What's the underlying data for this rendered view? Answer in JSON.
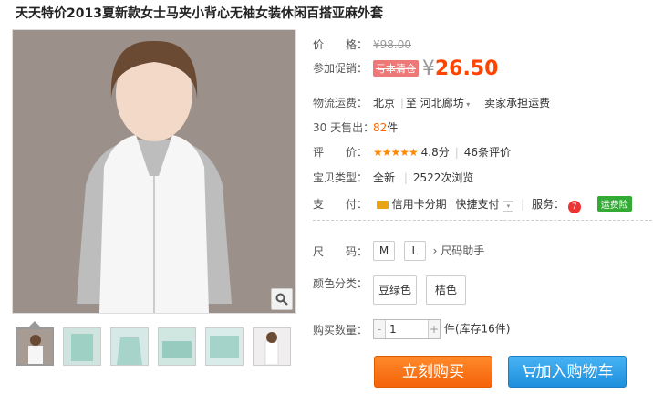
{
  "title": "天天特价2013夏新款女士马夹小背心无袖女装休闲百搭亚麻外套",
  "price": {
    "label": "价　　格：",
    "original": "¥98.00"
  },
  "promo": {
    "label": "参加促销：",
    "tag": "亏本清仓",
    "yen": "¥",
    "value": "26.50"
  },
  "shipping": {
    "label": "物流运费：",
    "from": "北京",
    "to_prefix": "至",
    "to": "河北廊坊",
    "fee": "卖家承担运费"
  },
  "sold": {
    "label": "30 天售出：",
    "count": "82",
    "unit": "件"
  },
  "rating": {
    "label": "评　　价：",
    "stars": "★★★★★",
    "score": "4.8分",
    "reviews": "46条评价"
  },
  "item_type": {
    "label": "宝贝类型：",
    "type": "全新",
    "views": "2522次浏览"
  },
  "payment": {
    "label": "支　　付：",
    "card": "信用卡分期",
    "quick": "快捷支付",
    "service_label": "服务：",
    "service_badge": "运费险"
  },
  "size": {
    "label": "尺　　码：",
    "options": [
      "M",
      "L"
    ],
    "helper": "尺码助手"
  },
  "color": {
    "label": "颜色分类：",
    "options": [
      "豆绿色",
      "桔色"
    ]
  },
  "quantity": {
    "label": "购买数量：",
    "value": "1",
    "unit": "件",
    "stock": "(库存16件)"
  },
  "buttons": {
    "buy": "立刻购买",
    "cart": "加入购物车"
  },
  "colors": {
    "accent": "#ff4400",
    "buy": "#f5620a",
    "cart": "#1e8fdc"
  }
}
